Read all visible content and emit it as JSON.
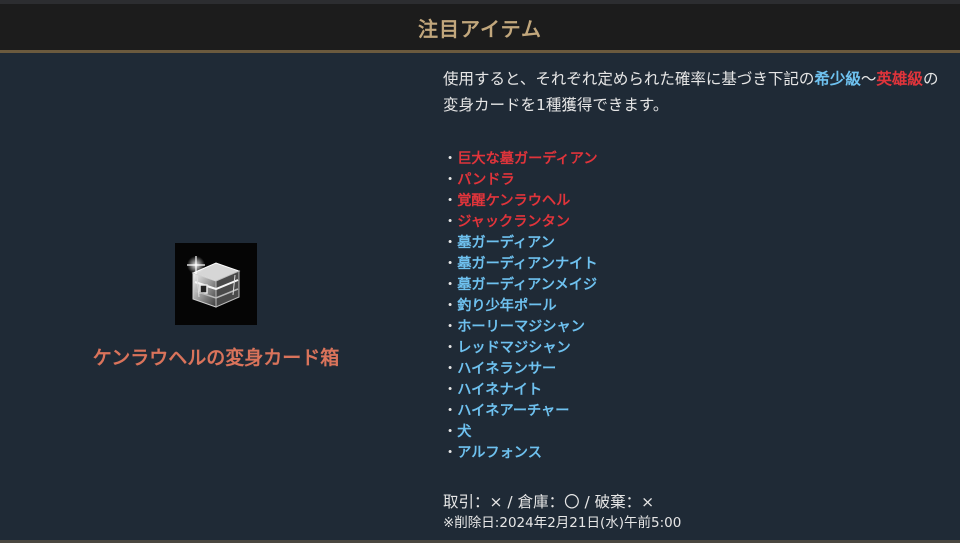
{
  "header": {
    "title": "注目アイテム"
  },
  "item": {
    "name": "ケンラウヘルの変身カード箱",
    "icon": "treasure-chest-icon"
  },
  "description": {
    "part1": "使用すると、それぞれ定められた確率に基づき下記の",
    "rare_label": "希少級",
    "tilde": "～",
    "hero_label": "英雄級",
    "part2": "の変身カードを1種獲得できます。"
  },
  "colors": {
    "rare": "#6ec1ef",
    "hero": "#e0343b",
    "header_title": "#c2a77c",
    "item_name": "#d9735b"
  },
  "cards": [
    {
      "bullet": "・",
      "name": "巨大な墓ガーディアン",
      "grade": "hero"
    },
    {
      "bullet": "・",
      "name": "パンドラ",
      "grade": "hero"
    },
    {
      "bullet": "・",
      "name": "覚醒ケンラウヘル",
      "grade": "hero"
    },
    {
      "bullet": "・",
      "name": "ジャックランタン",
      "grade": "hero"
    },
    {
      "bullet": "・",
      "name": "墓ガーディアン",
      "grade": "rare"
    },
    {
      "bullet": "・",
      "name": "墓ガーディアンナイト",
      "grade": "rare"
    },
    {
      "bullet": "・",
      "name": "墓ガーディアンメイジ",
      "grade": "rare"
    },
    {
      "bullet": "・",
      "name": "釣り少年ポール",
      "grade": "rare"
    },
    {
      "bullet": "・",
      "name": "ホーリーマジシャン",
      "grade": "rare"
    },
    {
      "bullet": "・",
      "name": "レッドマジシャン",
      "grade": "rare"
    },
    {
      "bullet": "・",
      "name": "ハイネランサー",
      "grade": "rare"
    },
    {
      "bullet": "・",
      "name": "ハイネナイト",
      "grade": "rare"
    },
    {
      "bullet": "・",
      "name": "ハイネアーチャー",
      "grade": "rare"
    },
    {
      "bullet": "・",
      "name": "犬",
      "grade": "rare"
    },
    {
      "bullet": "・",
      "name": "アルフォンス",
      "grade": "rare"
    }
  ],
  "trade_info": "取引：× / 倉庫：〇 / 破棄：×",
  "deletion_note": "※削除日:2024年2月21日(水)午前5:00"
}
